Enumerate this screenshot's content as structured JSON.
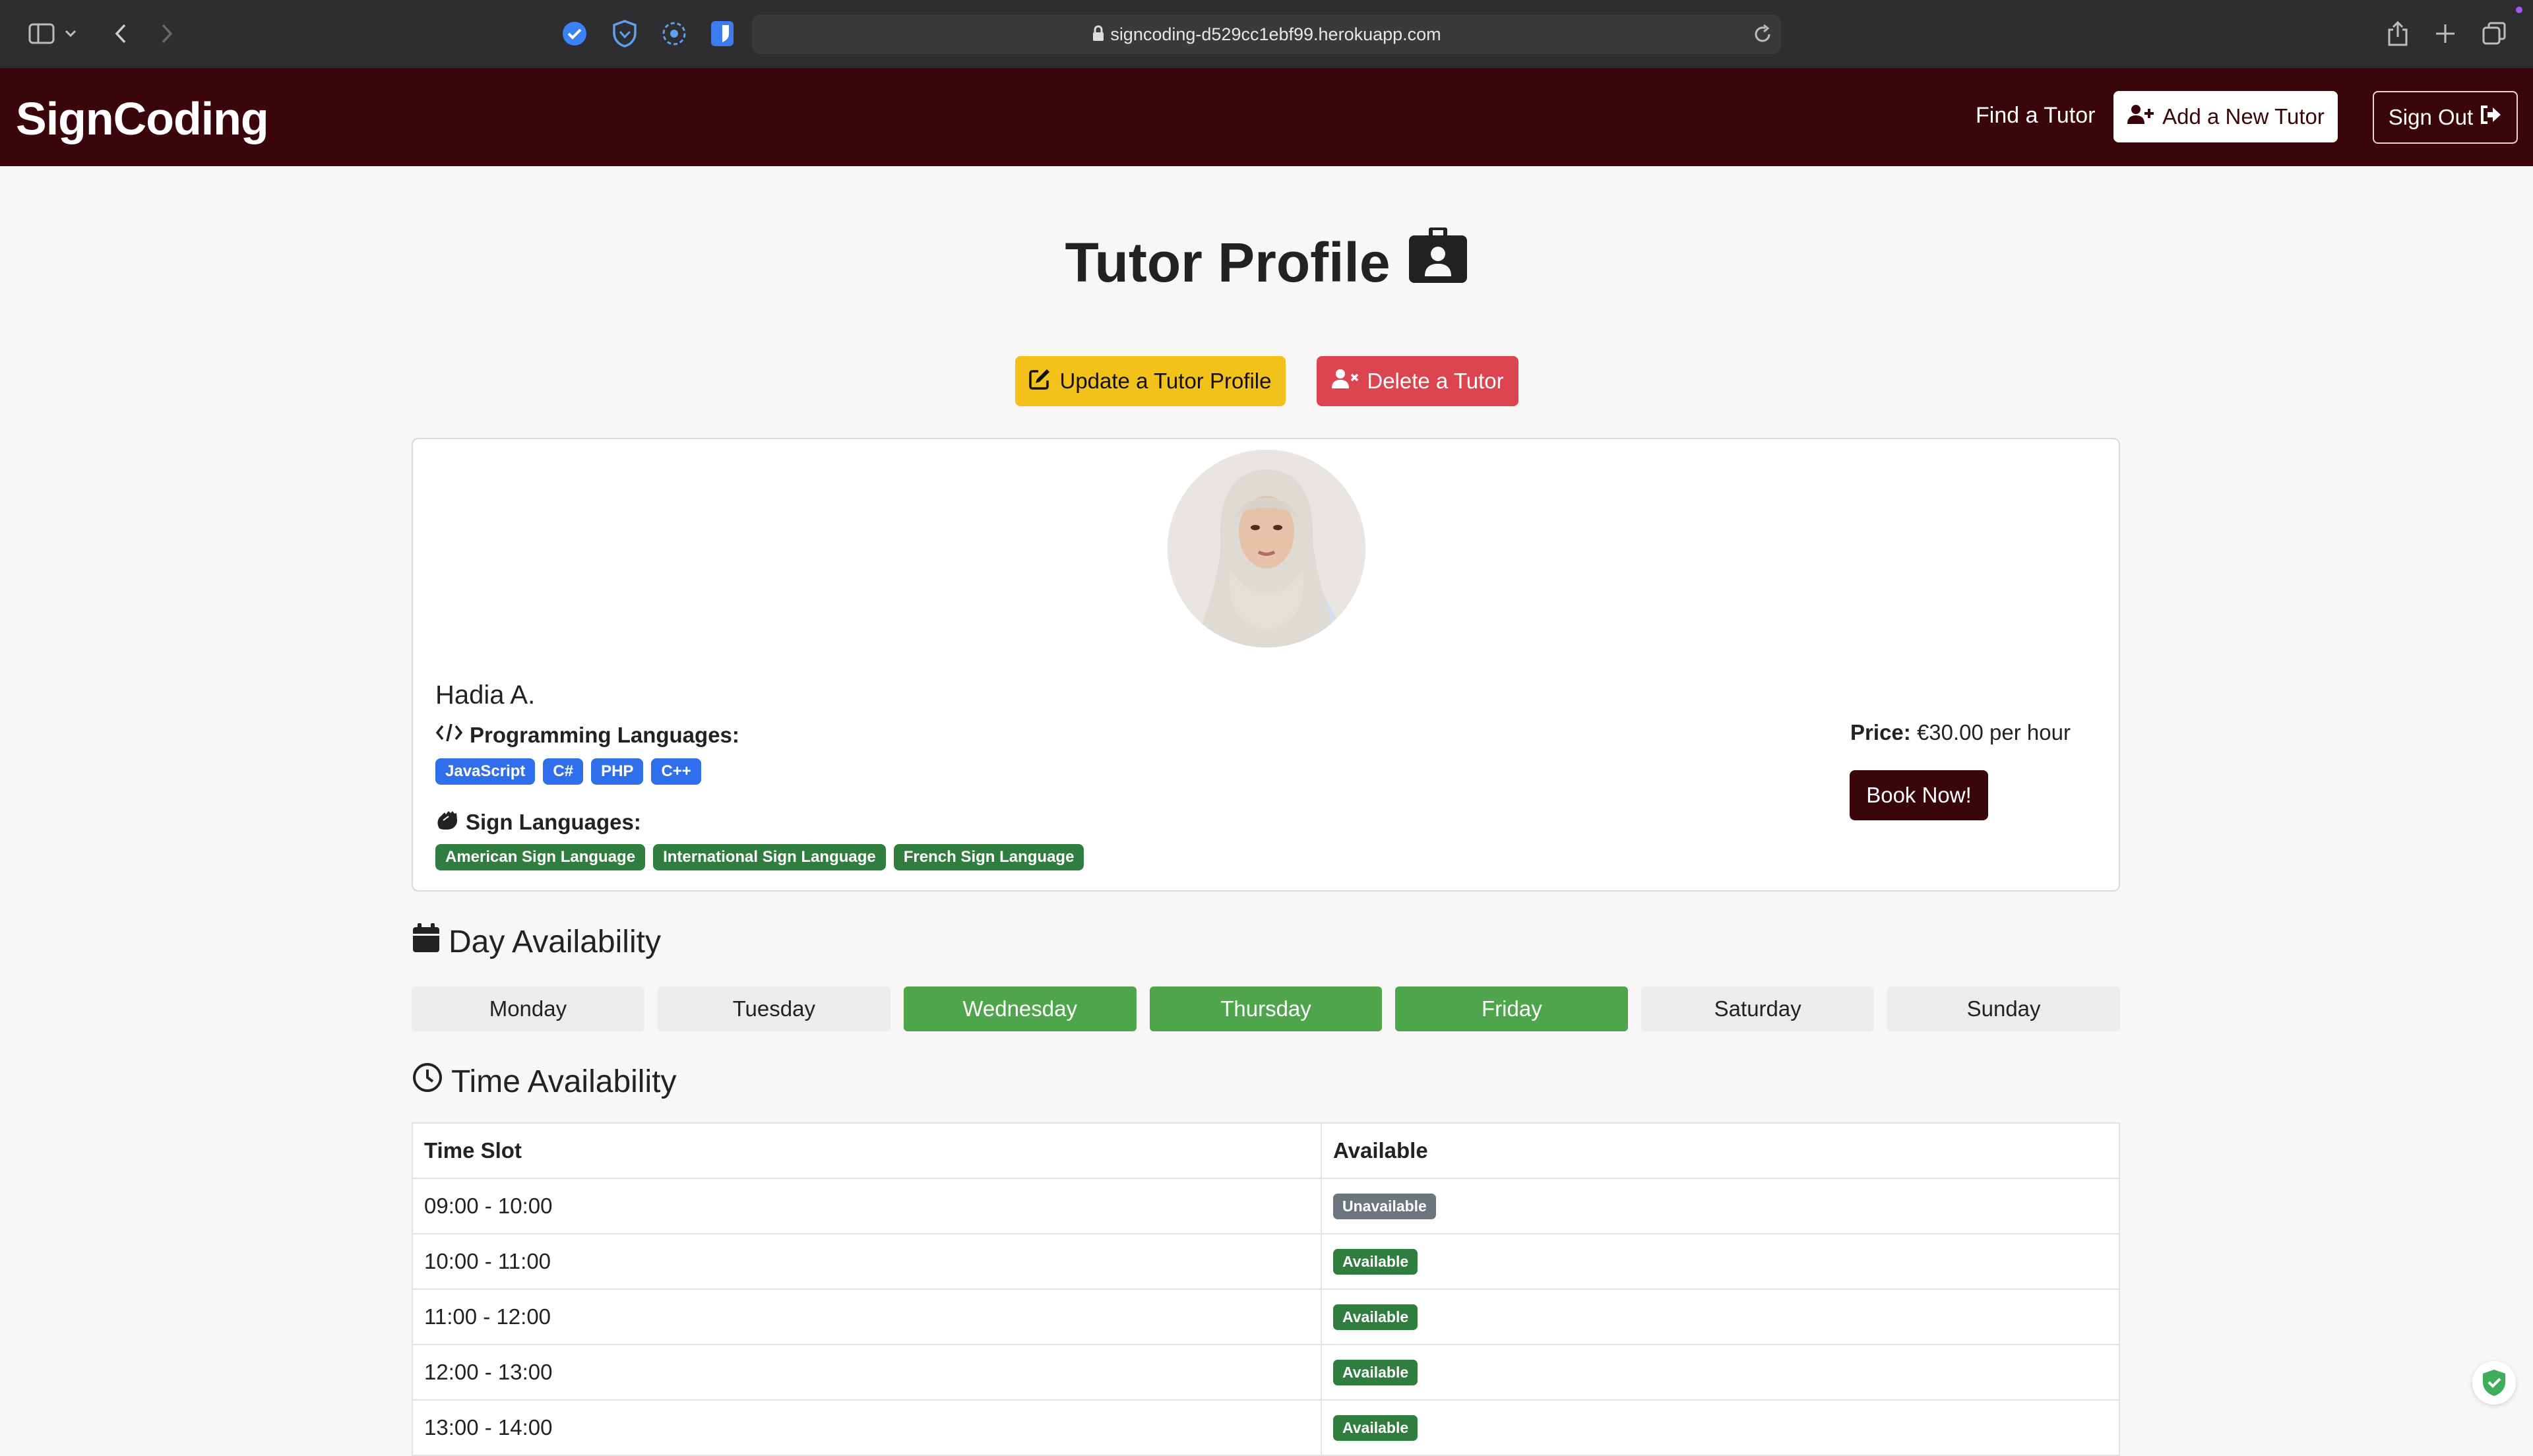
{
  "browser": {
    "url": "signcoding-d529cc1ebf99.herokuapp.com",
    "icons": [
      "sidebar-icon",
      "chevron-down-icon",
      "back-icon",
      "forward-icon",
      "extension-check-icon",
      "shield-extension-icon",
      "dots-extension-icon",
      "bitwarden-icon",
      "reader-icon",
      "lock-icon",
      "reload-icon",
      "share-icon",
      "new-tab-icon",
      "tabs-icon"
    ]
  },
  "nav": {
    "brand": "SignCoding",
    "find_tutor": "Find a Tutor",
    "add_tutor": "Add a New Tutor",
    "sign_out": "Sign Out"
  },
  "page": {
    "title": "Tutor Profile",
    "update_button": "Update a Tutor Profile",
    "delete_button": "Delete a Tutor"
  },
  "tutor": {
    "name": "Hadia A.",
    "programming_label": "Programming Languages:",
    "programming_languages": [
      "JavaScript",
      "C#",
      "PHP",
      "C++"
    ],
    "sign_label": "Sign Languages:",
    "sign_languages": [
      "American Sign Language",
      "International Sign Language",
      "French Sign Language"
    ],
    "price_label": "Price:",
    "price_value": "€30.00 per hour",
    "book_button": "Book Now!"
  },
  "day_availability": {
    "heading": "Day Availability",
    "days": [
      {
        "label": "Monday",
        "available": false
      },
      {
        "label": "Tuesday",
        "available": false
      },
      {
        "label": "Wednesday",
        "available": true
      },
      {
        "label": "Thursday",
        "available": true
      },
      {
        "label": "Friday",
        "available": true
      },
      {
        "label": "Saturday",
        "available": false
      },
      {
        "label": "Sunday",
        "available": false
      }
    ],
    "available_color": "#4ea54b",
    "unavailable_color": "#ececec"
  },
  "time_availability": {
    "heading": "Time Availability",
    "columns": [
      "Time Slot",
      "Available"
    ],
    "rows": [
      {
        "slot": "09:00 - 10:00",
        "status": "Unavailable"
      },
      {
        "slot": "10:00 - 11:00",
        "status": "Available"
      },
      {
        "slot": "11:00 - 12:00",
        "status": "Available"
      },
      {
        "slot": "12:00 - 13:00",
        "status": "Available"
      },
      {
        "slot": "13:00 - 14:00",
        "status": "Available"
      }
    ],
    "available_color": "#2f7d3f",
    "unavailable_color": "#6c757d"
  },
  "colors": {
    "navbar": "#3a060b",
    "update_button": "#f2c21b",
    "delete_button": "#dc4450",
    "programming_badge": "#2f6fec",
    "sign_badge": "#2f7d3f"
  }
}
